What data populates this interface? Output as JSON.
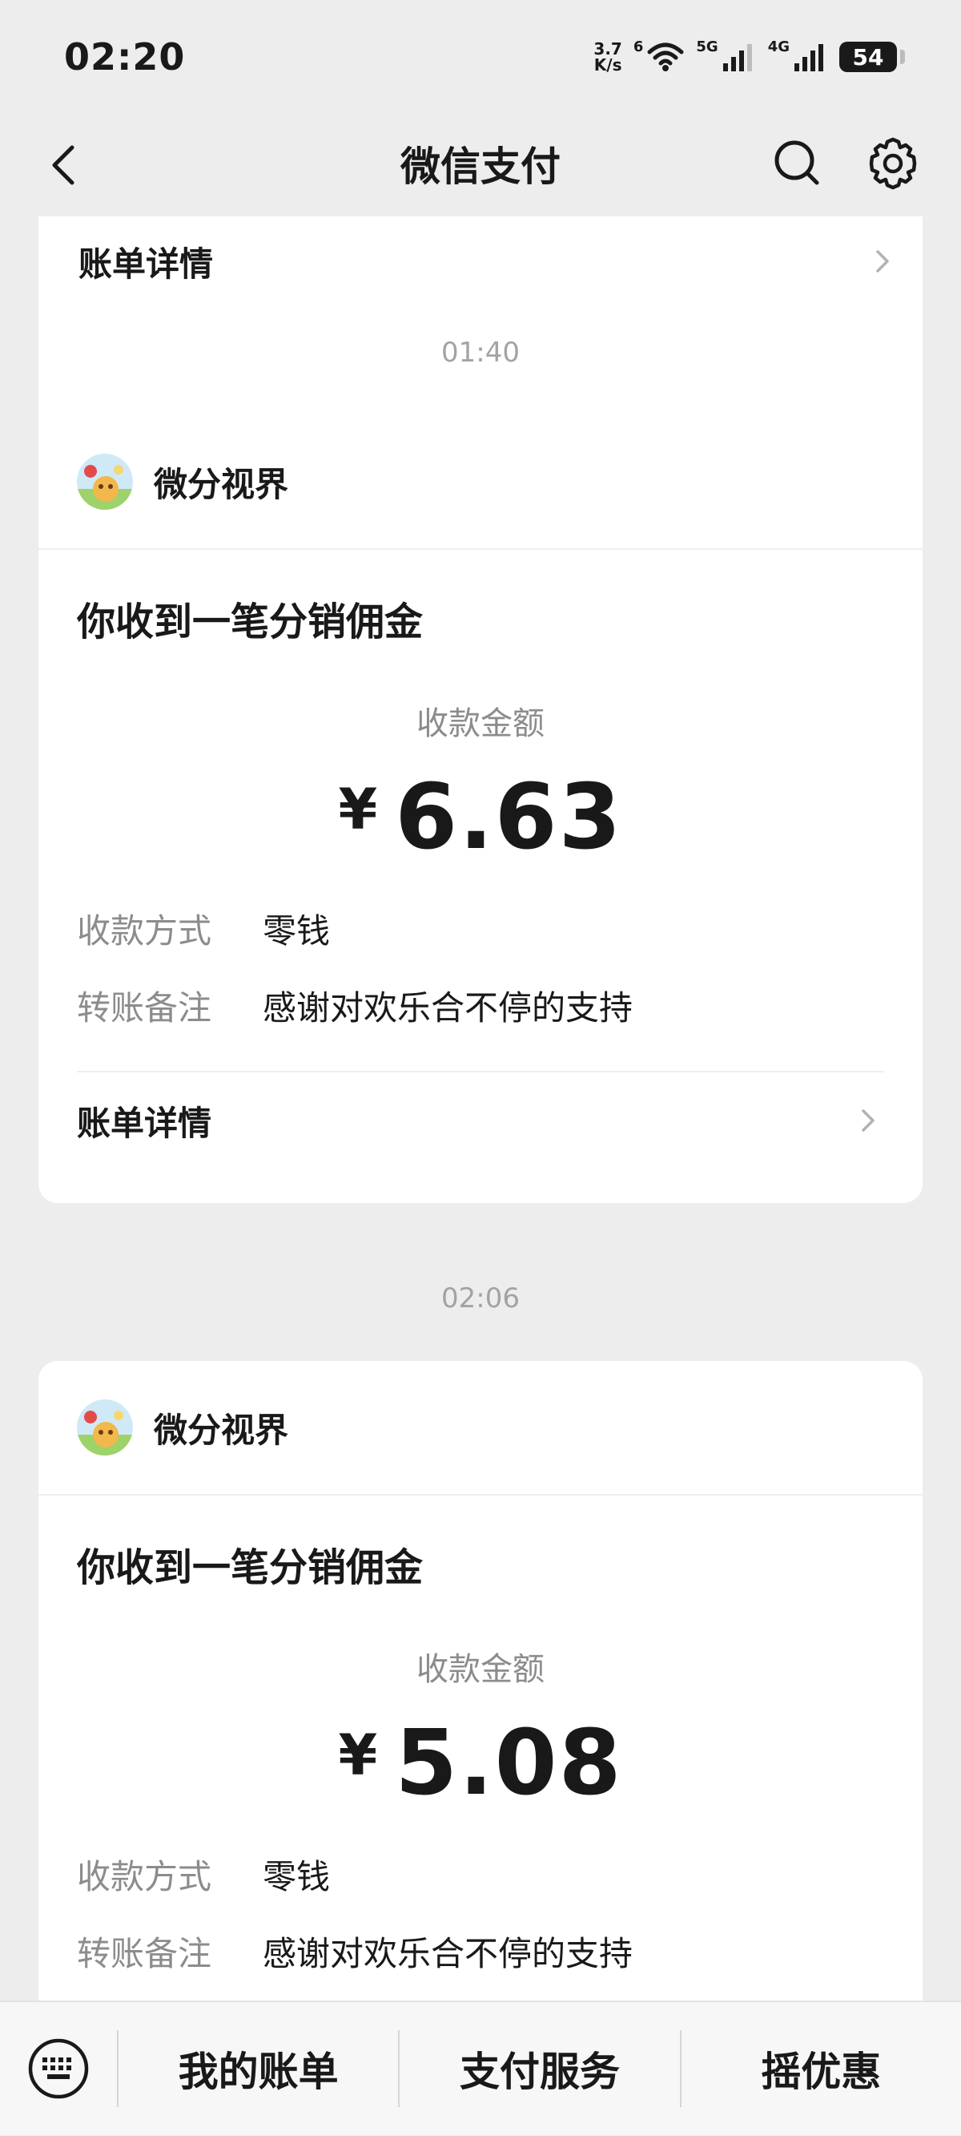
{
  "status_bar": {
    "time": "02:20",
    "net_speed_value": "3.7",
    "net_speed_unit": "K/s",
    "wifi_sub": "6",
    "signal1_label": "5G",
    "signal2_label": "4G",
    "battery": "54"
  },
  "nav": {
    "title": "微信支付"
  },
  "top_partial_card": {
    "detail_label": "账单详情"
  },
  "messages": [
    {
      "time": "01:40",
      "merchant": "微分视界",
      "title": "你收到一笔分销佣金",
      "amount_label": "收款金额",
      "currency": "¥",
      "amount": "6.63",
      "method_key": "收款方式",
      "method_value": "零钱",
      "note_key": "转账备注",
      "note_value": "感谢对欢乐合不停的支持",
      "detail_label": "账单详情"
    },
    {
      "time": "02:06",
      "merchant": "微分视界",
      "title": "你收到一笔分销佣金",
      "amount_label": "收款金额",
      "currency": "¥",
      "amount": "5.08",
      "method_key": "收款方式",
      "method_value": "零钱",
      "note_key": "转账备注",
      "note_value": "感谢对欢乐合不停的支持"
    }
  ],
  "bottom_menu": {
    "items": [
      "我的账单",
      "支付服务",
      "摇优惠"
    ]
  },
  "icons": {
    "back": "chevron-left-icon",
    "search": "search-icon",
    "settings": "gear-icon",
    "keyboard": "keyboard-icon",
    "chevron": "chevron-right-icon"
  }
}
